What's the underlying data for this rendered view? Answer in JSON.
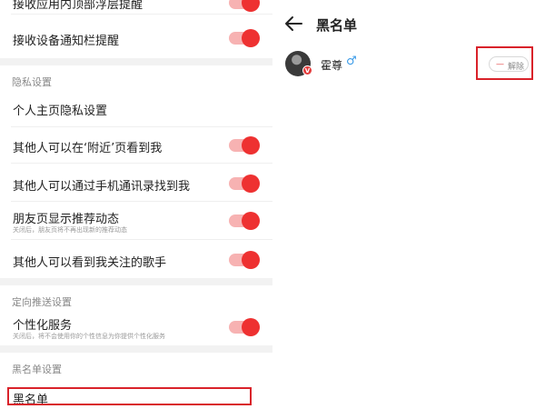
{
  "left": {
    "rows": [
      {
        "label": "接收应用内顶部浮层提醒",
        "toggle": true
      },
      {
        "label": "接收设备通知栏提醒",
        "toggle": true
      }
    ],
    "privacy": {
      "section_title": "隐私设置",
      "items": [
        {
          "label": "个人主页隐私设置",
          "toggle": false
        },
        {
          "label": "其他人可以在‘附近’页看到我",
          "toggle": true
        },
        {
          "label": "其他人可以通过手机通讯录找到我",
          "toggle": true
        },
        {
          "label": "朋友页显示推荐动态",
          "sub": "关闭后，朋友页将不再出现新的推荐动态",
          "toggle": true
        },
        {
          "label": "其他人可以看到我关注的歌手",
          "toggle": true
        }
      ]
    },
    "push": {
      "section_title": "定向推送设置",
      "items": [
        {
          "label": "个性化服务",
          "sub": "关闭后，将不会使用你的个性信息为你提供个性化服务",
          "toggle": true
        }
      ]
    },
    "blacklist": {
      "section_title": "黑名单设置",
      "item_label": "黑名单"
    }
  },
  "right": {
    "title": "黑名单",
    "user": {
      "name": "霍尊",
      "gender_symbol": "♂",
      "badge": "V"
    },
    "unblock": {
      "minus": "—",
      "label": "解除"
    }
  },
  "colors": {
    "accent": "#ee3131",
    "toggle_track": "#f7b2b2",
    "highlight": "#d9222a"
  }
}
